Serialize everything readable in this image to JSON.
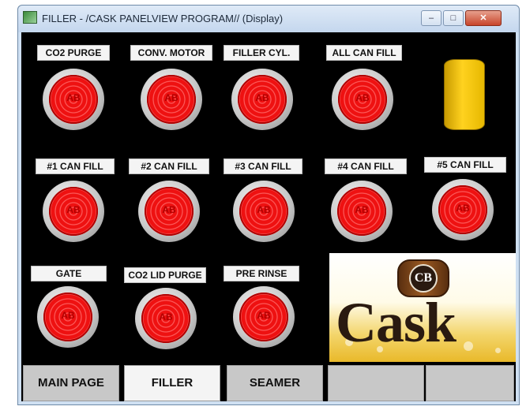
{
  "window": {
    "title": "FILLER - /CASK PANELVIEW PROGRAM// (Display)",
    "minimize": "–",
    "maximize": "□",
    "close": "✕"
  },
  "row1": [
    "CO2 PURGE",
    "CONV. MOTOR",
    "FILLER CYL.",
    "ALL CAN FILL"
  ],
  "row2": [
    "#1 CAN FILL",
    "#2 CAN FILL",
    "#3 CAN FILL",
    "#4 CAN FILL",
    "#5 CAN FILL"
  ],
  "row3": [
    "GATE",
    "CO2 LID PURGE",
    "PRE RINSE"
  ],
  "button_text": "AB",
  "logo": {
    "badge": "CB",
    "text": "Cask"
  },
  "nav": [
    "MAIN PAGE",
    "FILLER",
    "SEAMER",
    "",
    ""
  ],
  "colors": {
    "button_red": "#ee1111",
    "can_yellow": "#ffd21f",
    "display_bg": "#000000"
  }
}
